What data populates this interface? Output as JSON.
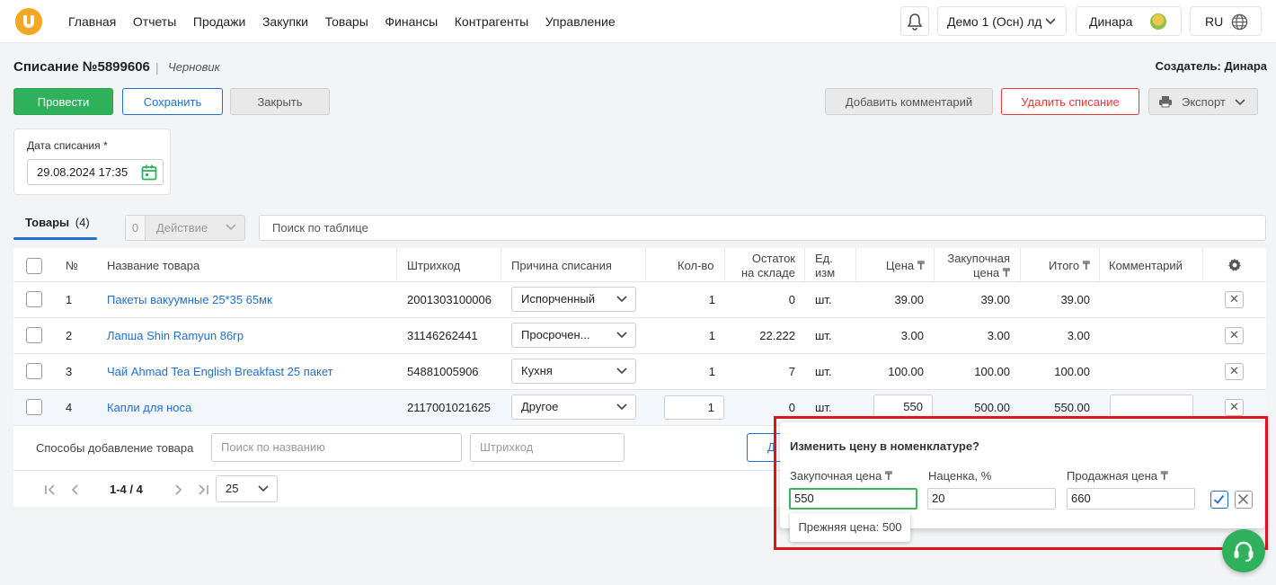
{
  "nav": {
    "items": [
      "Главная",
      "Отчеты",
      "Продажи",
      "Закупки",
      "Товары",
      "Финансы",
      "Контрагенты",
      "Управление"
    ],
    "company": "Демо 1 (Осн) лд",
    "user": "Динара",
    "lang": "RU"
  },
  "doc": {
    "title": "Списание №5899606",
    "status": "Черновик",
    "creator": "Создатель: Динара",
    "buttons": {
      "post": "Провести",
      "save": "Сохранить",
      "close": "Закрыть",
      "comment": "Добавить комментарий",
      "delete": "Удалить списание",
      "export": "Экспорт"
    },
    "date_label": "Дата списания *",
    "date_value": "29.08.2024 17:35"
  },
  "toolbar": {
    "tab_label": "Товары",
    "tab_count": "(4)",
    "selected_count": "0",
    "action_label": "Действие",
    "search_placeholder": "Поиск по таблице"
  },
  "table": {
    "headers": {
      "num": "№",
      "name": "Название товара",
      "barcode": "Штрихкод",
      "reason": "Причина списания",
      "qty": "Кол-во",
      "stock_1": "Остаток",
      "stock_2": "на складе",
      "unit_1": "Ед.",
      "unit_2": "изм",
      "price": "Цена ₸",
      "purchase_1": "Закупочная",
      "purchase_2": "цена ₸",
      "total": "Итого ₸",
      "comment": "Комментарий"
    },
    "rows": [
      {
        "num": "1",
        "name": "Пакеты вакуумные 25*35 65мк",
        "barcode": "2001303100006",
        "reason": "Испорченный",
        "qty": "1",
        "stock": "0",
        "unit": "шт.",
        "price": "39.00",
        "purchase": "39.00",
        "total": "39.00"
      },
      {
        "num": "2",
        "name": "Лапша Shin Ramyun 86гр",
        "barcode": "31146262441",
        "reason": "Просрочен...",
        "qty": "1",
        "stock": "22.222",
        "unit": "шт.",
        "price": "3.00",
        "purchase": "3.00",
        "total": "3.00"
      },
      {
        "num": "3",
        "name": "Чай Ahmad Tea English Breakfast 25 пакет",
        "barcode": "54881005906",
        "reason": "Кухня",
        "qty": "1",
        "stock": "7",
        "unit": "шт.",
        "price": "100.00",
        "purchase": "100.00",
        "total": "100.00"
      },
      {
        "num": "4",
        "name": "Капли для носа",
        "barcode": "2117001021625",
        "reason": "Другое",
        "qty": "1",
        "stock": "0",
        "unit": "шт.",
        "price": "550",
        "purchase": "500.00",
        "total": "550.00"
      }
    ],
    "add_label": "Способы добавление товара",
    "add_search_placeholder": "Поиск по названию",
    "add_barcode_placeholder": "Штрихкод",
    "add_button_partial": "Д",
    "pager_text": "1-4 / 4",
    "page_size": "25"
  },
  "popover": {
    "title": "Изменить цену в номенклатуре?",
    "purchase_label": "Закупочная цена ₸",
    "markup_label": "Наценка, %",
    "sale_label": "Продажная цена ₸",
    "purchase_value": "550",
    "markup_value": "20",
    "sale_value": "660",
    "prev_price": "Прежняя цена: 500"
  },
  "colors": {
    "accent_green": "#2fb15b",
    "accent_blue": "#1f6fcf",
    "danger_red": "#e53935",
    "highlight_red": "#e0141e",
    "logo_orange": "#f7a823"
  }
}
